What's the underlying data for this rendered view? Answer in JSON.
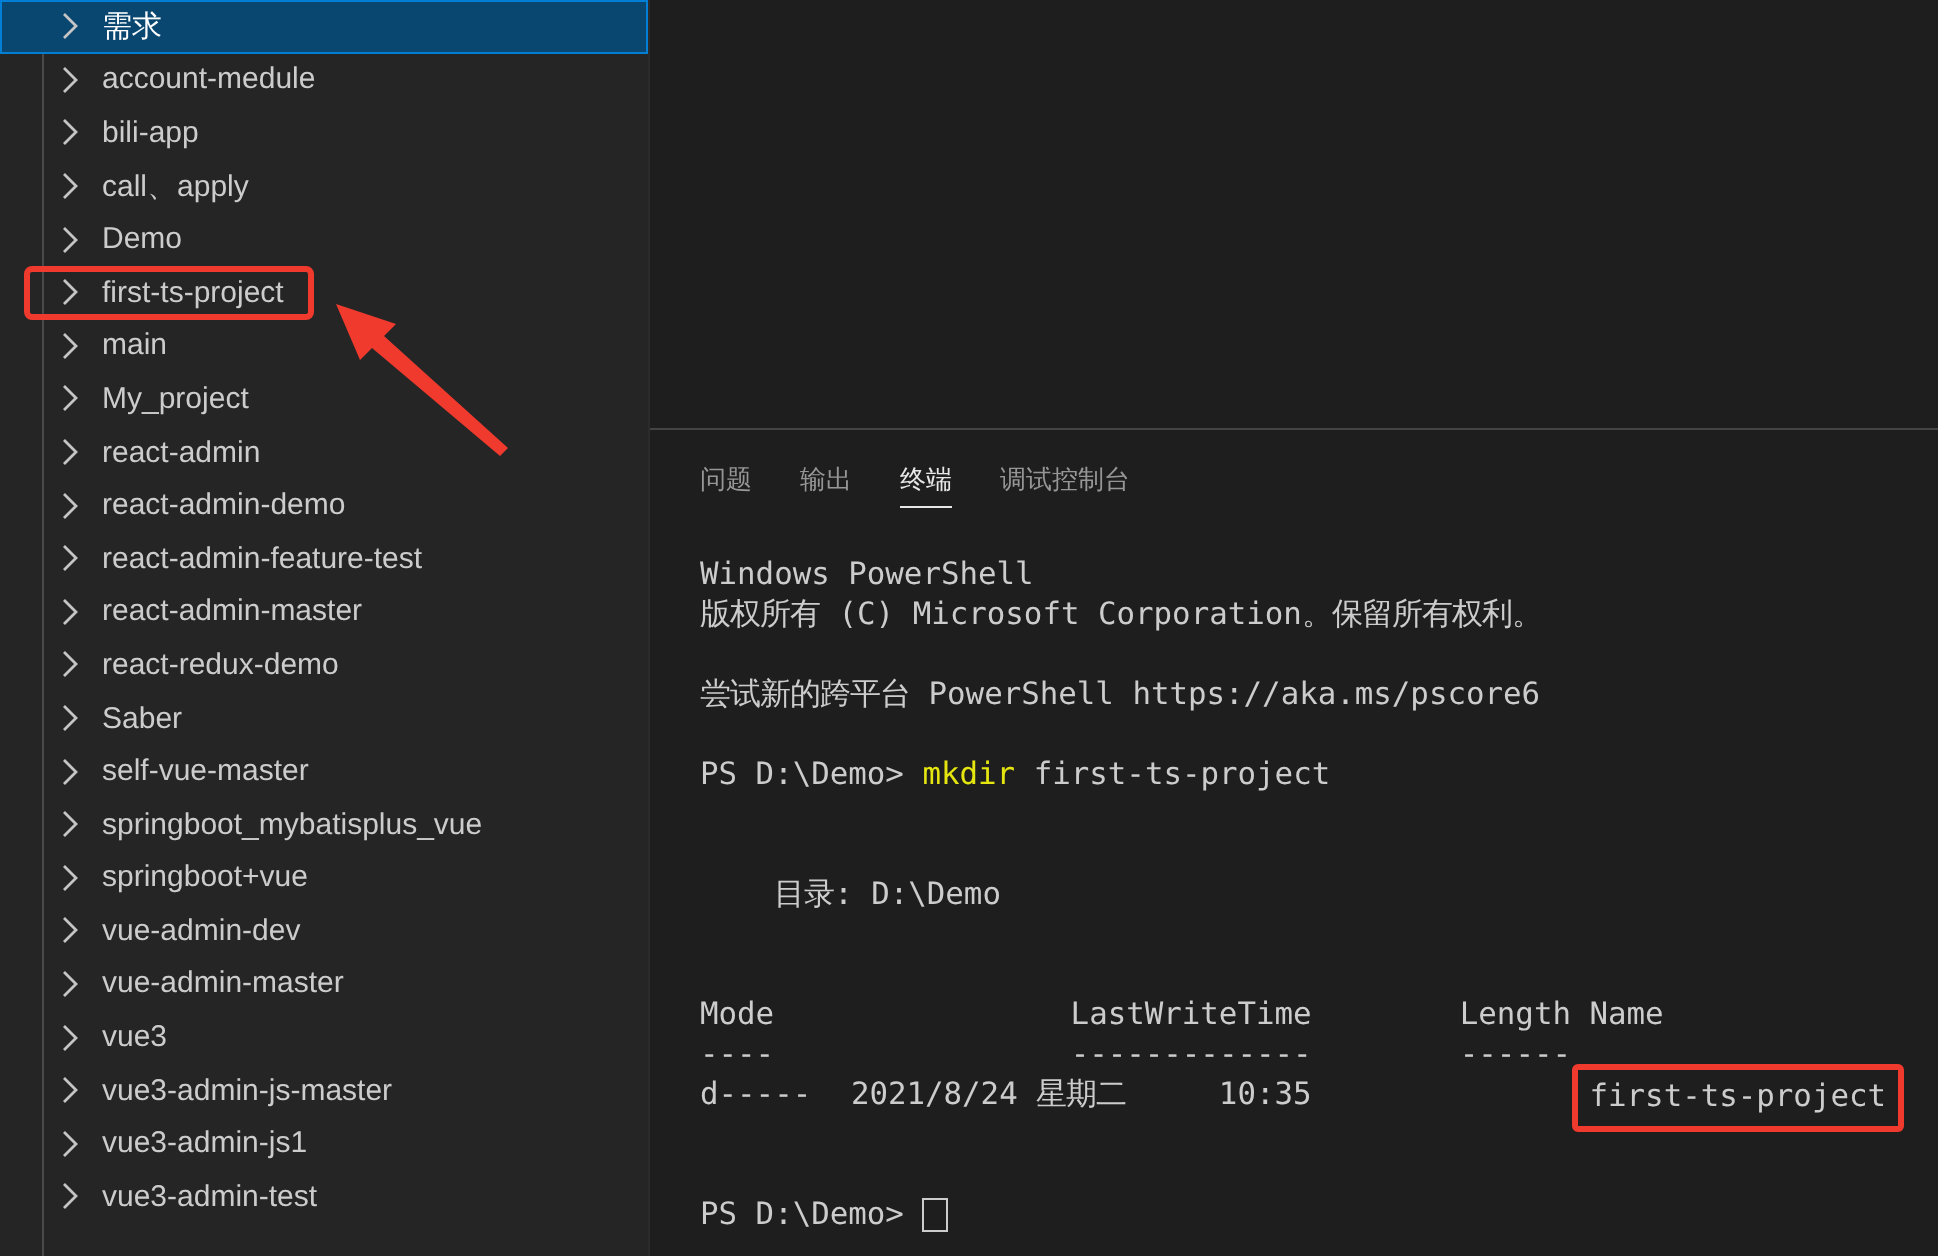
{
  "explorer": {
    "items": [
      {
        "label": "需求",
        "selected": true,
        "highlighted": false,
        "arrow": false
      },
      {
        "label": "account-medule",
        "selected": false,
        "highlighted": false,
        "arrow": false
      },
      {
        "label": "bili-app",
        "selected": false,
        "highlighted": false,
        "arrow": false
      },
      {
        "label": "call、apply",
        "selected": false,
        "highlighted": false,
        "arrow": false
      },
      {
        "label": "Demo",
        "selected": false,
        "highlighted": false,
        "arrow": false
      },
      {
        "label": "first-ts-project",
        "selected": false,
        "highlighted": true,
        "arrow": true
      },
      {
        "label": "main",
        "selected": false,
        "highlighted": false,
        "arrow": false
      },
      {
        "label": "My_project",
        "selected": false,
        "highlighted": false,
        "arrow": false
      },
      {
        "label": "react-admin",
        "selected": false,
        "highlighted": false,
        "arrow": false
      },
      {
        "label": "react-admin-demo",
        "selected": false,
        "highlighted": false,
        "arrow": false
      },
      {
        "label": "react-admin-feature-test",
        "selected": false,
        "highlighted": false,
        "arrow": false
      },
      {
        "label": "react-admin-master",
        "selected": false,
        "highlighted": false,
        "arrow": false
      },
      {
        "label": "react-redux-demo",
        "selected": false,
        "highlighted": false,
        "arrow": false
      },
      {
        "label": "Saber",
        "selected": false,
        "highlighted": false,
        "arrow": false
      },
      {
        "label": "self-vue-master",
        "selected": false,
        "highlighted": false,
        "arrow": false
      },
      {
        "label": "springboot_mybatisplus_vue",
        "selected": false,
        "highlighted": false,
        "arrow": false
      },
      {
        "label": "springboot+vue",
        "selected": false,
        "highlighted": false,
        "arrow": false
      },
      {
        "label": "vue-admin-dev",
        "selected": false,
        "highlighted": false,
        "arrow": false
      },
      {
        "label": "vue-admin-master",
        "selected": false,
        "highlighted": false,
        "arrow": false
      },
      {
        "label": "vue3",
        "selected": false,
        "highlighted": false,
        "arrow": false
      },
      {
        "label": "vue3-admin-js-master",
        "selected": false,
        "highlighted": false,
        "arrow": false
      },
      {
        "label": "vue3-admin-js1",
        "selected": false,
        "highlighted": false,
        "arrow": false
      },
      {
        "label": "vue3-admin-test",
        "selected": false,
        "highlighted": false,
        "arrow": false
      }
    ]
  },
  "panel": {
    "tabs": [
      {
        "label": "问题",
        "selected": false
      },
      {
        "label": "输出",
        "selected": false
      },
      {
        "label": "终端",
        "selected": true
      },
      {
        "label": "调试控制台",
        "selected": false
      }
    ],
    "terminal": {
      "lines": [
        {
          "kind": "text",
          "text": "Windows PowerShell"
        },
        {
          "kind": "text",
          "text": "版权所有 (C) Microsoft Corporation。保留所有权利。"
        },
        {
          "kind": "blank"
        },
        {
          "kind": "text",
          "text": "尝试新的跨平台 PowerShell https://aka.ms/pscore6"
        },
        {
          "kind": "blank"
        },
        {
          "kind": "command",
          "prompt": "PS D:\\Demo>",
          "command": "mkdir",
          "args": "first-ts-project"
        },
        {
          "kind": "blank"
        },
        {
          "kind": "blank"
        },
        {
          "kind": "heading",
          "text": "目录: D:\\Demo"
        },
        {
          "kind": "blank"
        },
        {
          "kind": "blank"
        },
        {
          "kind": "listing",
          "columns": [
            "Mode",
            "LastWriteTime",
            "Length",
            "Name"
          ],
          "underlines": [
            "----",
            "-------------",
            "------"
          ],
          "rows": [
            {
              "mode": "d-----",
              "date": "2021/8/24 星期二",
              "time": "10:35",
              "name": "first-ts-project",
              "highlighted": true
            }
          ]
        },
        {
          "kind": "blank"
        },
        {
          "kind": "blank"
        },
        {
          "kind": "prompt",
          "prompt": "PS D:\\Demo>",
          "cursor": true
        }
      ]
    }
  }
}
